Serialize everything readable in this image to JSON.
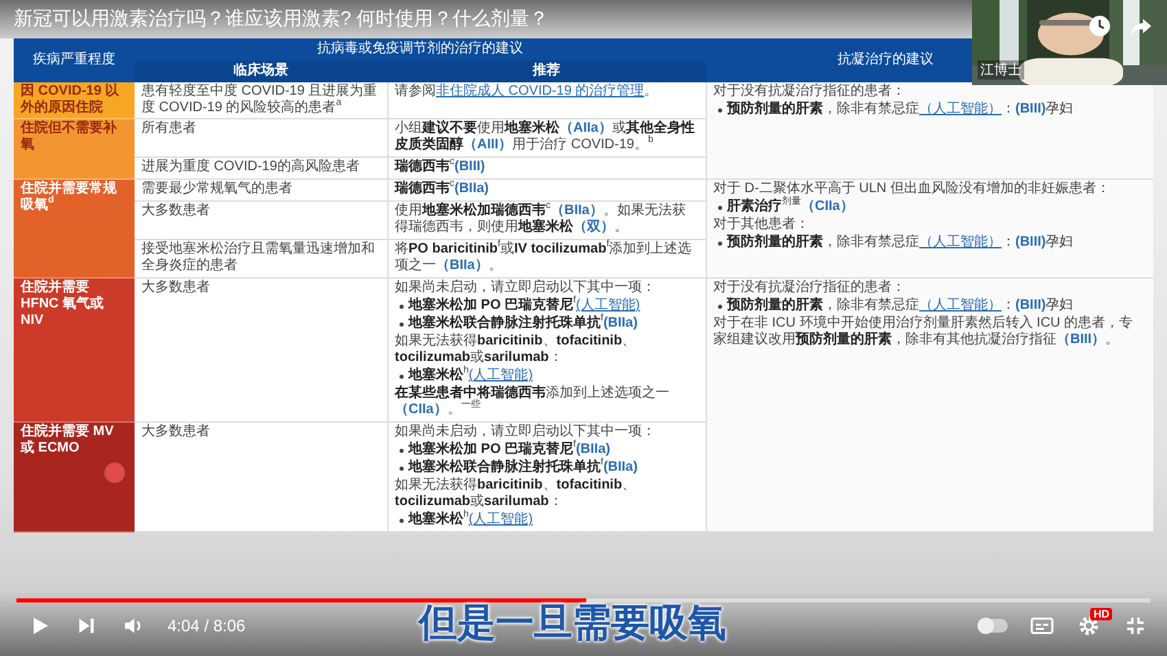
{
  "video_title": "新冠可以用激素治疗吗？谁应该用激素? 何时使用？什么剂量？",
  "table": {
    "headers": {
      "severity": "疾病严重程度",
      "group": "抗病毒或免疫调节剂的治疗的建议",
      "scenario": "临床场景",
      "recommendation": "推荐",
      "anticoagulation": "抗凝治疗的建议"
    },
    "sections": [
      {
        "anticoagulation": [
          {
            "kind": "para",
            "runs": [
              {
                "kind": "text",
                "text": "对于没有抗凝治疗指征的患者："
              }
            ]
          },
          {
            "kind": "bullet",
            "runs": [
              {
                "kind": "text",
                "text": "**预防剂量的肝素**，除非有禁忌症"
              },
              {
                "kind": "link",
                "text": "（人工智能）"
              },
              {
                "kind": "text",
                "text": "："
              },
              {
                "kind": "rating",
                "text": "(BIII)"
              },
              {
                "kind": "text",
                "text": "孕妇"
              }
            ]
          }
        ],
        "severities": [
          {
            "label": "因 COVID-19 以外的原因住院",
            "color": "#f5a623",
            "rows": [
              {
                "scenario": "患有轻度至中度 COVID-19 且进展为重度 COVID-19 的风险较高的患者$^{a}$",
                "recommendation": [
                  {
                    "kind": "para",
                    "runs": [
                      {
                        "kind": "text",
                        "text": "请参阅"
                      },
                      {
                        "kind": "link",
                        "text": "非住院成人 COVID-19 的治疗管理"
                      },
                      {
                        "kind": "text",
                        "text": "。"
                      }
                    ]
                  }
                ]
              }
            ]
          },
          {
            "label": "住院但不需要补氧",
            "color": "#f39632",
            "rows": [
              {
                "scenario": "所有患者",
                "recommendation": [
                  {
                    "kind": "para",
                    "runs": [
                      {
                        "kind": "text",
                        "text": "小组**建议不要**使用**地塞米松**"
                      },
                      {
                        "kind": "rating",
                        "text": "（AIIa）"
                      },
                      {
                        "kind": "text",
                        "text": "或**其他全身性皮质类固醇**"
                      },
                      {
                        "kind": "rating",
                        "text": "（AIII）"
                      },
                      {
                        "kind": "text",
                        "text": "用于治疗 COVID-19。$^{b}$"
                      }
                    ]
                  }
                ]
              },
              {
                "scenario": "进展为重度 COVID-19的高风险患者",
                "recommendation": [
                  {
                    "kind": "para",
                    "runs": [
                      {
                        "kind": "text",
                        "text": "**瑞德西韦**$^{c}$"
                      },
                      {
                        "kind": "rating",
                        "text": "(BIII)"
                      }
                    ]
                  }
                ]
              }
            ]
          }
        ]
      },
      {
        "anticoagulation": [
          {
            "kind": "para",
            "runs": [
              {
                "kind": "text",
                "text": "对于 D-二聚体水平高于 ULN 但出血风险没有增加的非妊娠患者："
              }
            ]
          },
          {
            "kind": "bullet",
            "runs": [
              {
                "kind": "text",
                "text": "**肝素治疗**$^{剂量}$"
              },
              {
                "kind": "rating",
                "text": "（CIIa）"
              }
            ]
          },
          {
            "kind": "para",
            "runs": [
              {
                "kind": "text",
                "text": "对于其他患者："
              }
            ]
          },
          {
            "kind": "bullet",
            "runs": [
              {
                "kind": "text",
                "text": "**预防剂量的肝素**，除非有禁忌症"
              },
              {
                "kind": "link",
                "text": "（人工智能）"
              },
              {
                "kind": "text",
                "text": "："
              },
              {
                "kind": "rating",
                "text": "(BIII)"
              },
              {
                "kind": "text",
                "text": "孕妇"
              }
            ]
          }
        ],
        "severities": [
          {
            "label": "住院并需要常规吸氧$^{d}$",
            "color": "#e2622a",
            "rows": [
              {
                "scenario": "需要最少常规氧气的患者",
                "recommendation": [
                  {
                    "kind": "para",
                    "runs": [
                      {
                        "kind": "text",
                        "text": "**瑞德西韦**$^{c}$"
                      },
                      {
                        "kind": "rating",
                        "text": "(BIIa)"
                      }
                    ]
                  }
                ]
              },
              {
                "scenario": "大多数患者",
                "recommendation": [
                  {
                    "kind": "para",
                    "runs": [
                      {
                        "kind": "text",
                        "text": "使用**地塞米松加瑞德西韦**$^{c}$"
                      },
                      {
                        "kind": "rating",
                        "text": "（BIIa）"
                      },
                      {
                        "kind": "text",
                        "text": "。如果无法获得瑞德西韦，则使用**地塞米松**"
                      },
                      {
                        "kind": "rating",
                        "text": "（双）"
                      },
                      {
                        "kind": "text",
                        "text": "。"
                      }
                    ]
                  }
                ]
              },
              {
                "scenario": "接受地塞米松治疗且需氧量迅速增加和全身炎症的患者",
                "recommendation": [
                  {
                    "kind": "para",
                    "runs": [
                      {
                        "kind": "text",
                        "text": "将**PO baricitinib**$^{f}$或**IV tocilizumab**$^{f}$添加到上述选项之一"
                      },
                      {
                        "kind": "rating",
                        "text": "（BIIa）"
                      },
                      {
                        "kind": "text",
                        "text": "。"
                      }
                    ]
                  }
                ]
              }
            ]
          }
        ]
      },
      {
        "anticoagulation": [
          {
            "kind": "para",
            "runs": [
              {
                "kind": "text",
                "text": "对于没有抗凝治疗指征的患者："
              }
            ]
          },
          {
            "kind": "bullet",
            "runs": [
              {
                "kind": "text",
                "text": "**预防剂量的肝素**，除非有禁忌症"
              },
              {
                "kind": "link",
                "text": "（人工智能）"
              },
              {
                "kind": "text",
                "text": "："
              },
              {
                "kind": "rating",
                "text": "(BIII)"
              },
              {
                "kind": "text",
                "text": "孕妇"
              }
            ]
          },
          {
            "kind": "para",
            "runs": [
              {
                "kind": "text",
                "text": "对于在非 ICU 环境中开始使用治疗剂量肝素然后转入 ICU 的患者，专家组建议改用**预防剂量的肝素**，除非有其他抗凝治疗指征"
              },
              {
                "kind": "rating",
                "text": "（BIII）"
              },
              {
                "kind": "text",
                "text": "。"
              }
            ]
          }
        ],
        "severities": [
          {
            "label": "住院并需要 HFNC 氧气或 NIV",
            "color": "#cc3a2a",
            "rows": [
              {
                "scenario": "大多数患者",
                "recommendation": [
                  {
                    "kind": "para",
                    "runs": [
                      {
                        "kind": "text",
                        "text": "如果尚未启动，请立即启动以下其中一项："
                      }
                    ]
                  },
                  {
                    "kind": "bullet",
                    "runs": [
                      {
                        "kind": "text",
                        "text": "**地塞米松加 PO 巴瑞克替尼**$^{f}$"
                      },
                      {
                        "kind": "link",
                        "text": "(人工智能)"
                      }
                    ]
                  },
                  {
                    "kind": "bullet",
                    "runs": [
                      {
                        "kind": "text",
                        "text": "**地塞米松联合静脉注射托珠单抗**$^{f}$"
                      },
                      {
                        "kind": "rating",
                        "text": "(BIIa)"
                      }
                    ]
                  },
                  {
                    "kind": "para",
                    "runs": [
                      {
                        "kind": "text",
                        "text": "如果无法获得**baricitinib**、**tofacitinib**、**tocilizumab**或**sarilumab**："
                      }
                    ]
                  },
                  {
                    "kind": "bullet",
                    "runs": [
                      {
                        "kind": "text",
                        "text": "**地塞米松**$^{h}$"
                      },
                      {
                        "kind": "link",
                        "text": "(人工智能)"
                      }
                    ]
                  },
                  {
                    "kind": "para",
                    "runs": [
                      {
                        "kind": "text",
                        "text": "**在某些患者中将瑞德西韦**添加到上述选项之一"
                      },
                      {
                        "kind": "rating",
                        "text": "（CIIa）"
                      },
                      {
                        "kind": "text",
                        "text": "。$^{一些}$"
                      }
                    ]
                  }
                ]
              }
            ]
          },
          {
            "label": "住院并需要 MV 或 ECMO",
            "color": "#a8261e",
            "marker": true,
            "rows": [
              {
                "scenario": "大多数患者",
                "recommendation": [
                  {
                    "kind": "para",
                    "runs": [
                      {
                        "kind": "text",
                        "text": "如果尚未启动，请立即启动以下其中一项："
                      }
                    ]
                  },
                  {
                    "kind": "bullet",
                    "runs": [
                      {
                        "kind": "text",
                        "text": "**地塞米松加 PO 巴瑞克替尼**$^{f}$"
                      },
                      {
                        "kind": "rating",
                        "text": "(BIIa)"
                      }
                    ]
                  },
                  {
                    "kind": "bullet",
                    "runs": [
                      {
                        "kind": "text",
                        "text": "**地塞米松联合静脉注射托珠单抗**$^{f}$"
                      },
                      {
                        "kind": "rating",
                        "text": "(BIIa)"
                      }
                    ]
                  },
                  {
                    "kind": "para",
                    "runs": [
                      {
                        "kind": "text",
                        "text": "如果无法获得**baricitinib**、**tofacitinib**、**tocilizumab**或**sarilumab**："
                      }
                    ]
                  },
                  {
                    "kind": "bullet",
                    "runs": [
                      {
                        "kind": "text",
                        "text": "**地塞米松**$^{h}$"
                      },
                      {
                        "kind": "link",
                        "text": "(人工智能)"
                      }
                    ]
                  }
                ]
              }
            ]
          }
        ]
      }
    ]
  },
  "webcam": {
    "kind": "picture",
    "name_tag": "江博士"
  },
  "player": {
    "progress": {
      "level": 0.502
    },
    "time": "4:04 / 8:06",
    "caption": "但是一旦需要吸氧",
    "autoplay": {
      "on": false
    },
    "hd": "HD"
  }
}
